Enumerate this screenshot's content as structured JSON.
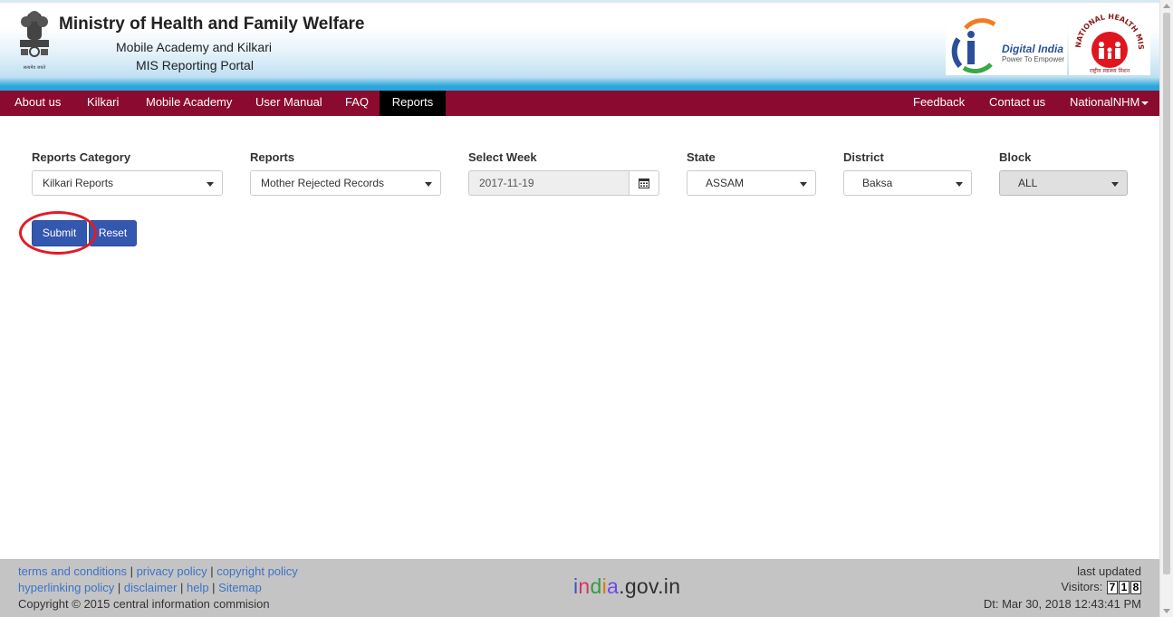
{
  "header": {
    "title": "Ministry of Health and Family Welfare",
    "subtitle1": "Mobile Academy and Kilkari",
    "subtitle2": "MIS Reporting Portal",
    "emblem_caption": "सत्यमेव जयते",
    "digital_india": "Digital India",
    "digital_india_tag": "Power To Empower",
    "nhm_text": "NATIONAL HEALTH MISSION",
    "nhm_caption": "राष्ट्रीय स्वास्थ्य मिशन"
  },
  "nav": {
    "left": [
      "About us",
      "Kilkari",
      "Mobile Academy",
      "User Manual",
      "FAQ",
      "Reports"
    ],
    "active": "Reports",
    "right": [
      "Feedback",
      "Contact us",
      "NationalNHM"
    ]
  },
  "filters": {
    "reports_category": {
      "label": "Reports Category",
      "value": "Kilkari Reports"
    },
    "reports": {
      "label": "Reports",
      "value": "Mother Rejected Records"
    },
    "select_week": {
      "label": "Select Week",
      "value": "2017-11-19"
    },
    "state": {
      "label": "State",
      "value": "ASSAM"
    },
    "district": {
      "label": "District",
      "value": "Baksa"
    },
    "block": {
      "label": "Block",
      "value": "ALL"
    }
  },
  "buttons": {
    "submit": "Submit",
    "reset": "Reset"
  },
  "footer": {
    "links_row1": [
      "terms and conditions",
      "privacy policy",
      "copyright policy"
    ],
    "links_row2": [
      "hyperlinking policy",
      "disclaimer",
      "help",
      "Sitemap"
    ],
    "copyright": "Copyright © 2015 central information commision",
    "india_gov": "india.gov.in",
    "last_updated": "last updated",
    "visitors_label": "Visitors:",
    "visitors_digits": [
      "7",
      "1",
      "8"
    ],
    "date": "Dt: Mar 30, 2018 12:43:41 PM"
  },
  "colors": {
    "navbar": "#8b0b2e",
    "active_tab": "#000000",
    "button": "#3457b0",
    "annotation_circle": "#e31b23",
    "footer_bg": "#c4c4c4",
    "link": "#3b73c9"
  }
}
